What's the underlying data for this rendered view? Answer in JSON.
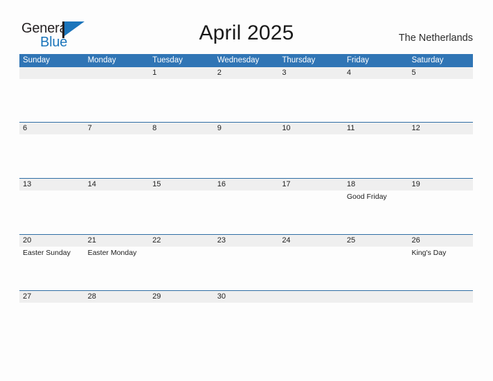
{
  "brand": {
    "name_part1": "General",
    "name_part2": "Blue",
    "color_dark": "#231f20",
    "color_blue": "#1b75bb"
  },
  "header": {
    "title": "April 2025",
    "region": "The Netherlands"
  },
  "theme": {
    "header_blue": "#3075b5",
    "row_line_blue": "#2e6da4",
    "band_gray": "#efefef",
    "page_bg": "#fdfdfd"
  },
  "calendar": {
    "month": "April",
    "year": "2025",
    "weekday_headers": [
      "Sunday",
      "Monday",
      "Tuesday",
      "Wednesday",
      "Thursday",
      "Friday",
      "Saturday"
    ],
    "weeks": [
      [
        {
          "day": "",
          "event": ""
        },
        {
          "day": "",
          "event": ""
        },
        {
          "day": "1",
          "event": ""
        },
        {
          "day": "2",
          "event": ""
        },
        {
          "day": "3",
          "event": ""
        },
        {
          "day": "4",
          "event": ""
        },
        {
          "day": "5",
          "event": ""
        }
      ],
      [
        {
          "day": "6",
          "event": ""
        },
        {
          "day": "7",
          "event": ""
        },
        {
          "day": "8",
          "event": ""
        },
        {
          "day": "9",
          "event": ""
        },
        {
          "day": "10",
          "event": ""
        },
        {
          "day": "11",
          "event": ""
        },
        {
          "day": "12",
          "event": ""
        }
      ],
      [
        {
          "day": "13",
          "event": ""
        },
        {
          "day": "14",
          "event": ""
        },
        {
          "day": "15",
          "event": ""
        },
        {
          "day": "16",
          "event": ""
        },
        {
          "day": "17",
          "event": ""
        },
        {
          "day": "18",
          "event": "Good Friday"
        },
        {
          "day": "19",
          "event": ""
        }
      ],
      [
        {
          "day": "20",
          "event": "Easter Sunday"
        },
        {
          "day": "21",
          "event": "Easter Monday"
        },
        {
          "day": "22",
          "event": ""
        },
        {
          "day": "23",
          "event": ""
        },
        {
          "day": "24",
          "event": ""
        },
        {
          "day": "25",
          "event": ""
        },
        {
          "day": "26",
          "event": "King's Day"
        }
      ],
      [
        {
          "day": "27",
          "event": ""
        },
        {
          "day": "28",
          "event": ""
        },
        {
          "day": "29",
          "event": ""
        },
        {
          "day": "30",
          "event": ""
        },
        {
          "day": "",
          "event": ""
        },
        {
          "day": "",
          "event": ""
        },
        {
          "day": "",
          "event": ""
        }
      ]
    ]
  }
}
